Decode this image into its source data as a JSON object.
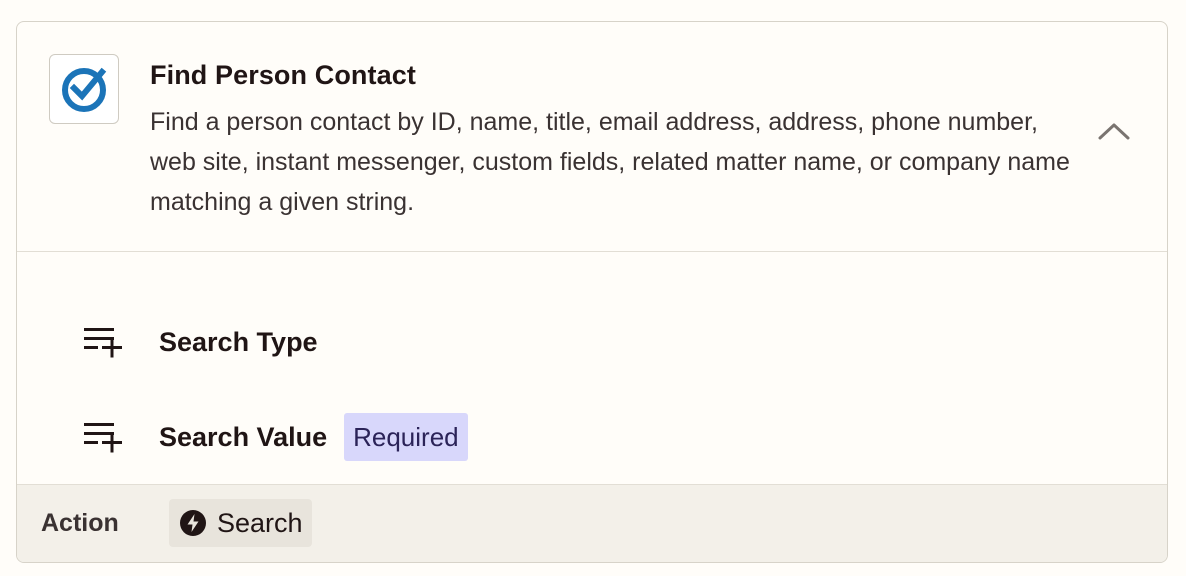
{
  "header": {
    "title": "Find Person Contact",
    "description": "Find a person contact by ID, name, title, email address, address, phone number, web site, instant messenger, custom fields, related matter name, or company name matching a given string.",
    "app_icon": "checkmark-circle-icon",
    "toggle_icon": "chevron-up-icon",
    "brand_color": "#1b74b8"
  },
  "fields": [
    {
      "label": "Search Type",
      "required": false,
      "icon": "add-list-icon"
    },
    {
      "label": "Search Value",
      "required": true,
      "badge": "Required",
      "icon": "add-list-icon"
    }
  ],
  "footer": {
    "label": "Action",
    "action_label": "Search",
    "action_icon": "lightning-bolt-icon"
  },
  "colors": {
    "background": "#fffdf9",
    "footer_bg": "#f3f0e9",
    "badge_bg": "#d8d7fb",
    "text": "#201515"
  }
}
